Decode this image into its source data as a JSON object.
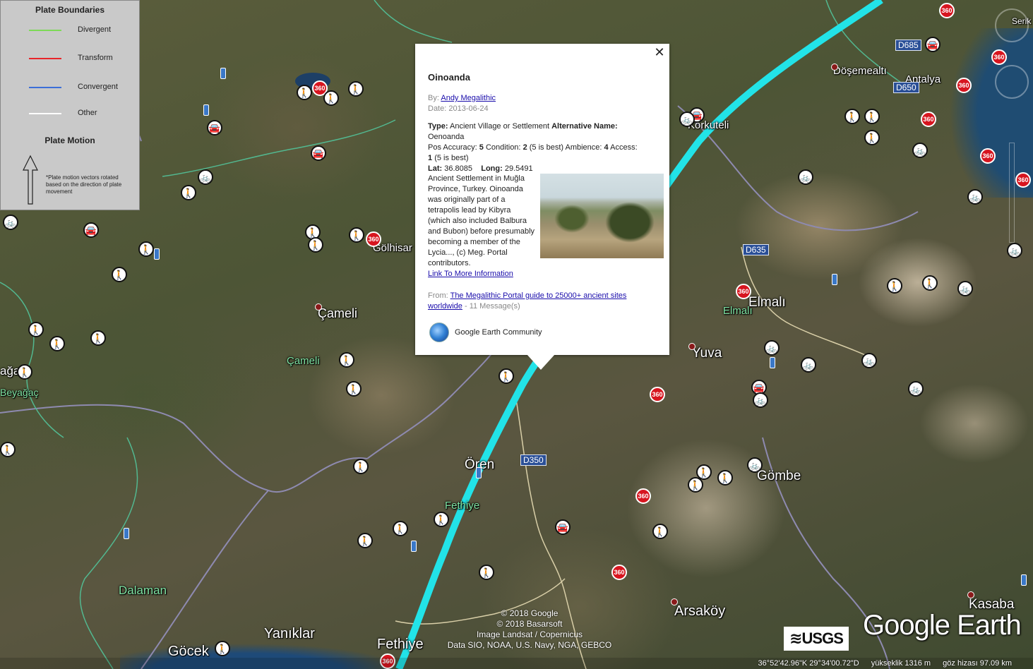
{
  "legend": {
    "boundaries_title": "Plate Boundaries",
    "items": [
      {
        "label": "Divergent",
        "color": "#7ed957"
      },
      {
        "label": "Transform",
        "color": "#e8252a"
      },
      {
        "label": "Convergent",
        "color": "#3b6fd8"
      },
      {
        "label": "Other",
        "color": "#ffffff"
      }
    ],
    "motion_title": "Plate Motion",
    "note": "*Plate motion vectors rotated based on the direction of plate movement"
  },
  "popup": {
    "title": "Oinoanda",
    "by_label": "By:",
    "author": "Andy Megalithic",
    "date_label": "Date:",
    "date": "2013-06-24",
    "type_label": "Type:",
    "type_value": "Ancient Village or Settlement",
    "alt_label": "Alternative Name:",
    "alt_value": "Oenoanda",
    "pos_label": "Pos Accuracy:",
    "pos_value": "5",
    "cond_label": "Condition:",
    "cond_value": "2",
    "cond_note": "(5 is best)",
    "amb_label": "Ambience:",
    "amb_value": "4",
    "access_label": "Access:",
    "access_value": "1",
    "access_note": "(5 is best)",
    "lat_label": "Lat:",
    "lat_value": "36.8085",
    "long_label": "Long:",
    "long_value": "29.5491",
    "description": "Ancient Settlement in Muğla Province, Turkey. Oinoanda was originally part of a tetrapolis lead by Kibyra (which also included Balbura and Bubon) before presumably becoming a member of the Lycia..., (c) Meg. Portal contributors.",
    "more_link": "Link To More Information",
    "from_label": "From:",
    "from_link": "The Megalithic Portal guide to 25000+ ancient sites worldwide",
    "messages": "- 11 Message(s)",
    "community": "Google Earth Community",
    "close": "✕"
  },
  "places": {
    "dosemealti": "Döşemealtı",
    "antalya": "Antalya",
    "serik": "Serik",
    "korkuteli": "Korkuteli",
    "golhisar": "Gölhisar",
    "cameli": "Çameli",
    "cameli_district": "Çameli",
    "beyagac_a": "ağaç",
    "beyagac_b": "Beyağaç",
    "elmali": "Elmalı",
    "elmali_district": "Elmalı",
    "yuva": "Yuva",
    "oren": "Ören",
    "fethiye_district": "Fethiye",
    "gombe": "Gömbe",
    "dalaman": "Dalaman",
    "yaniklar": "Yanıklar",
    "gocek": "Göcek",
    "fethiye": "Fethiye",
    "arsakoy": "Arsaköy",
    "kasaba": "Kasaba"
  },
  "roads": {
    "d685": "D685",
    "d650": "D650",
    "d635": "D635",
    "d350": "D350"
  },
  "markers": {
    "pano_label": "360",
    "hiker_icon": "🚶",
    "car_icon": "🚘",
    "bike_icon": "🚲"
  },
  "attribution": {
    "line1": "© 2018 Google",
    "line2": "© 2018 Basarsoft",
    "line3": "Image Landsat / Copernicus",
    "line4": "Data SIO, NOAA, U.S. Navy, NGA, GEBCO"
  },
  "logos": {
    "usgs": "≋USGS",
    "google_earth": "Google Earth"
  },
  "status": {
    "coords": "36°52'42.96\"K 29°34'00.72\"D",
    "elevation": "yükseklik 1316 m",
    "eye_alt": "göz hizası 97.09 km"
  },
  "colors": {
    "plate_boundary_line": "#22e3e8",
    "road_badge": "#2a4f97"
  }
}
